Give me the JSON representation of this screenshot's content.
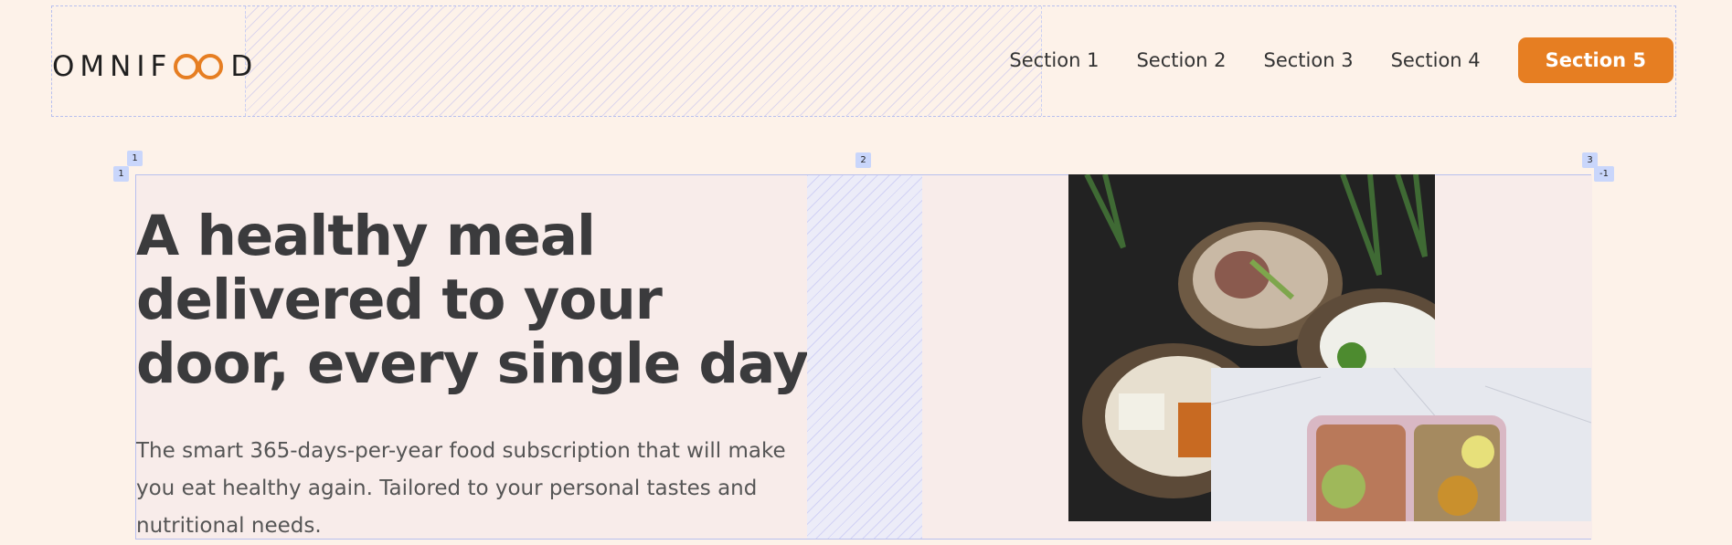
{
  "header": {
    "logo_left": "OMNIF",
    "logo_right": "D",
    "nav": [
      {
        "label": "Section 1"
      },
      {
        "label": "Section 2"
      },
      {
        "label": "Section 3"
      },
      {
        "label": "Section 4"
      }
    ],
    "cta_label": "Section 5"
  },
  "hero": {
    "title": "A healthy meal delivered to your door, every single day",
    "description": "The smart 365-days-per-year food subscription that will make you eat healthy again. Tailored to your personal tastes and nutritional needs."
  },
  "grid_overlay": {
    "line_badges": [
      "1",
      "2",
      "3"
    ],
    "row_badges": [
      "1",
      "-1"
    ]
  },
  "colors": {
    "background": "#fdf2e9",
    "accent": "#e67e22",
    "text_dark": "#3b3b3d"
  },
  "images": [
    "food-bowls-photo",
    "meal-prep-containers-photo"
  ]
}
